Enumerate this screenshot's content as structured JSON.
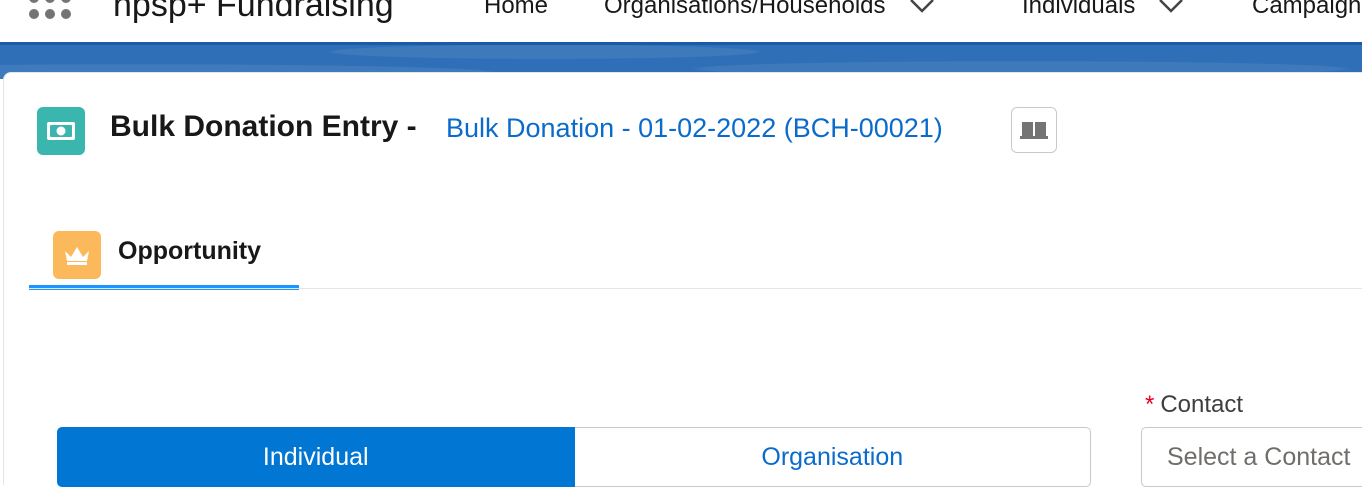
{
  "app": {
    "name": "npsp+ Fundraising"
  },
  "nav": {
    "items": [
      {
        "label": "Home"
      },
      {
        "label": "Organisations/Households"
      },
      {
        "label": "Individuals"
      },
      {
        "label": "Campaigns"
      }
    ]
  },
  "header": {
    "title": "Bulk Donation Entry -",
    "subtitle": "Bulk Donation - 01-02-2022 (BCH-00021)",
    "icon": "money-icon",
    "icon_color": "#3ab6ae"
  },
  "tabs": [
    {
      "label": "Opportunity",
      "icon": "crown-icon",
      "icon_color": "#fcb95b",
      "active": true
    }
  ],
  "donor_type": {
    "options": [
      "Individual",
      "Organisation"
    ],
    "selected": "Individual"
  },
  "contact": {
    "required_marker": "*",
    "label": "Contact",
    "placeholder": "Select a Contact"
  },
  "colors": {
    "brand_blue": "#0176d3",
    "link_blue": "#0b6bcb",
    "tab_underline": "#1b96ff",
    "band": "#2f6fb7"
  }
}
